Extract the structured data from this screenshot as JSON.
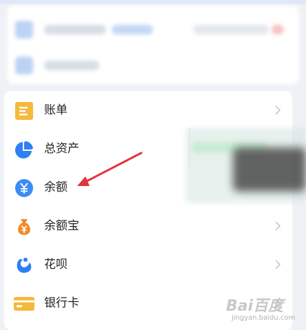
{
  "menu": {
    "items": [
      {
        "label": "账单",
        "icon": "bill-icon",
        "icon_color": "#f5b93b",
        "has_chevron": true
      },
      {
        "label": "总资产",
        "icon": "pie-chart-icon",
        "icon_color": "#2f7ff5",
        "has_chevron": false
      },
      {
        "label": "余额",
        "icon": "yuan-coin-icon",
        "icon_color": "#3b8cf5",
        "has_chevron": false
      },
      {
        "label": "余额宝",
        "icon": "money-bag-icon",
        "icon_color": "#f08b2a",
        "has_chevron": true
      },
      {
        "label": "花呗",
        "icon": "huabei-icon",
        "icon_color": "#2f7ff5",
        "has_chevron": true
      },
      {
        "label": "银行卡",
        "icon": "bank-card-icon",
        "icon_color": "#f5b93b",
        "has_chevron": true
      }
    ]
  },
  "annotation": {
    "arrow_color": "#e2343a"
  },
  "watermark": {
    "main": "Bai百度",
    "sub": "jingyan.baidu.com"
  }
}
